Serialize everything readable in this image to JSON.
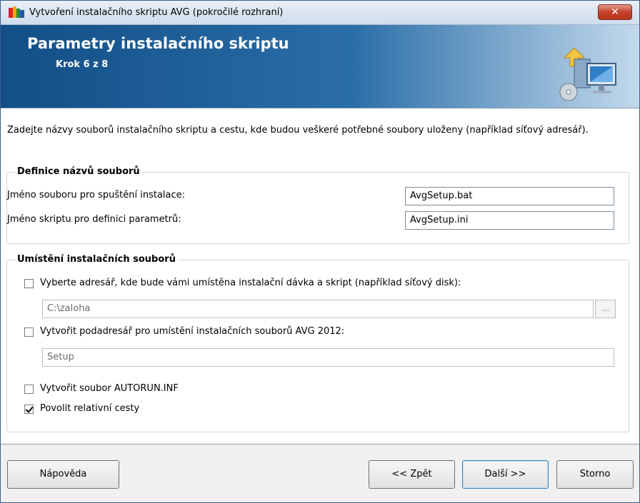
{
  "window": {
    "title": "Vytvoření instalačního skriptu AVG (pokročilé rozhraní)",
    "close_label": "✕"
  },
  "banner": {
    "title": "Parametry instalačního skriptu",
    "step": "Krok 6 z 8"
  },
  "description": "Zadejte názvy souborů instalačního skriptu a cestu, kde budou veškeré potřebné soubory uloženy (například síťový adresář).",
  "file_names_group": {
    "title": "Definice názvů souborů",
    "setup_label": "Jméno souboru pro spuštění instalace:",
    "setup_value": "AvgSetup.bat",
    "script_label": "Jméno skriptu pro definici parametrů:",
    "script_value": "AvgSetup.ini"
  },
  "location_group": {
    "title": "Umístění instalačních souborů",
    "select_dir_label": "Vyberte adresář, kde bude vámi umístěna instalační dávka a skript (například síťový disk):",
    "select_dir_checked": false,
    "dir_value": "C:\\zaloha",
    "browse_label": "...",
    "subdir_label": "Vytvořit podadresář pro umístění instalačních souborů AVG 2012:",
    "subdir_checked": false,
    "subdir_value": "Setup",
    "autorun_label": "Vytvořit soubor AUTORUN.INF",
    "autorun_checked": false,
    "relative_label": "Povolit relativní cesty",
    "relative_checked": true
  },
  "buttons": {
    "help": "Nápověda",
    "back": "<< Zpět",
    "next": "Další >>",
    "cancel": "Storno"
  },
  "colors": {
    "banner_dark": "#134e86",
    "banner_light": "#c3d9ec",
    "close_red": "#c4412a"
  }
}
